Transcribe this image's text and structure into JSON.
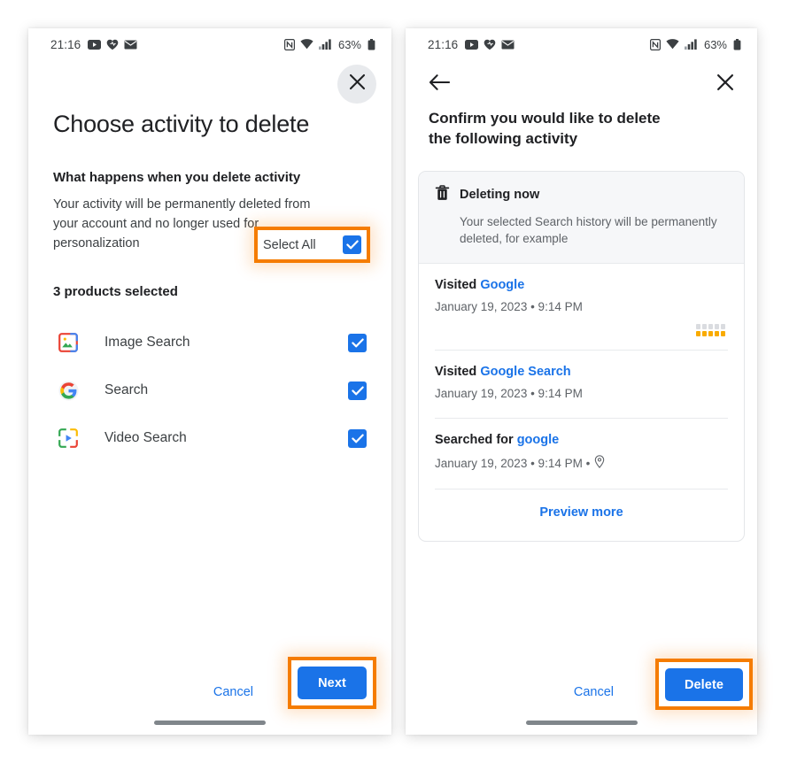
{
  "status_bar": {
    "time": "21:16",
    "left_icons": [
      "youtube-icon",
      "health-heart-icon",
      "mail-icon"
    ],
    "right_icons": [
      "nfc-icon",
      "wifi-icon",
      "cellular-signal-icon"
    ],
    "battery_percent": "63%",
    "battery_icon": "battery-icon"
  },
  "colors": {
    "accent_blue": "#1a73e8",
    "annotation_orange": "#f57c00",
    "text_primary": "#202124",
    "text_secondary": "#5f6368",
    "card_header_bg": "#f6f7f9",
    "close_circle_bg": "#e8eaed"
  },
  "left_screen": {
    "close_icon": "close-icon",
    "title": "Choose activity to delete",
    "section_heading": "What happens when you delete activity",
    "section_body": "Your activity will be permanently deleted from your account and no longer used for personalization",
    "selected_count": "3 products selected",
    "select_all_label": "Select All",
    "select_all_checked": true,
    "products": [
      {
        "label": "Image Search",
        "icon": "image-search-icon",
        "checked": true
      },
      {
        "label": "Search",
        "icon": "google-g-icon",
        "checked": true
      },
      {
        "label": "Video Search",
        "icon": "video-search-icon",
        "checked": true
      }
    ],
    "cancel_label": "Cancel",
    "next_label": "Next"
  },
  "right_screen": {
    "back_icon": "back-arrow-icon",
    "close_icon": "close-icon",
    "title": "Confirm you would like to delete the following activity",
    "card": {
      "header_icon": "trash-icon",
      "header_title": "Deleting now",
      "header_subtitle": "Your selected Search history will be permanently deleted, for example",
      "activities": [
        {
          "action": "Visited",
          "target": "Google",
          "meta": "January 19, 2023 • 9:14 PM",
          "has_rating": true,
          "rating_stars": 5,
          "has_location": false
        },
        {
          "action": "Visited",
          "target": "Google Search",
          "meta": "January 19, 2023 • 9:14 PM",
          "has_rating": false,
          "has_location": false
        },
        {
          "action": "Searched for",
          "target": "google",
          "meta": "January 19, 2023 • 9:14 PM •",
          "has_rating": false,
          "has_location": true,
          "location_icon": "location-pin-icon"
        }
      ],
      "preview_more_label": "Preview more"
    },
    "cancel_label": "Cancel",
    "delete_label": "Delete"
  }
}
